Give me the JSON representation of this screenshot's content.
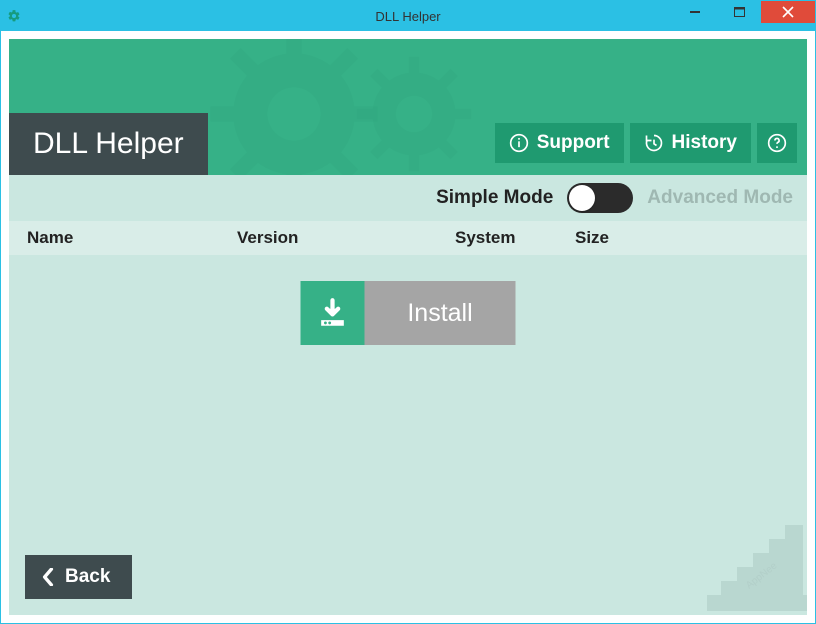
{
  "window": {
    "title": "DLL Helper"
  },
  "header": {
    "appTitle": "DLL Helper",
    "support": "Support",
    "history": "History"
  },
  "mode": {
    "simple": "Simple Mode",
    "advanced": "Advanced Mode",
    "active": "simple"
  },
  "columns": {
    "name": "Name",
    "version": "Version",
    "system": "System",
    "size": "Size"
  },
  "actions": {
    "install": "Install",
    "back": "Back"
  },
  "colors": {
    "accent": "#36b187",
    "accentDark": "#1f9a70",
    "panelDark": "#3e4b4e",
    "surface": "#cae7e0",
    "border": "#2bc0e4",
    "closeRed": "#e04b3a"
  }
}
